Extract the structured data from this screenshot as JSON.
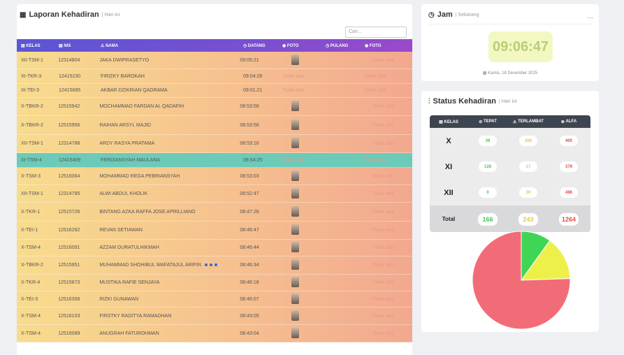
{
  "attendance": {
    "title": "Laporan Kehadiran",
    "subtitle": "| Hari ini",
    "search_placeholder": "Cari...",
    "columns": [
      "KELAS",
      "NIS",
      "NAMA",
      "DATANG",
      "FOTO",
      "PULANG",
      "FOTO"
    ],
    "rows": [
      {
        "kelas": "XII-TSM-1",
        "nis": "12314804",
        "nama": "JAKA DWIPRASETYO",
        "datang": "09:05:21",
        "foto_datang": "photo",
        "foto_pulang": "Tidak ada"
      },
      {
        "kelas": "XI-TKR-3",
        "nis": "12415230",
        "nama": "FIRIZKY BAROKAH",
        "datang": "09:04:28",
        "foto_datang": "Tidak ada",
        "foto_pulang": "Tidak ada"
      },
      {
        "kelas": "XI-TEI-3",
        "nis": "12415685",
        "nama": "AKBAR DZIKRIAN QADRAMA",
        "datang": "09:01:21",
        "foto_datang": "Tidak ada",
        "foto_pulang": "Tidak ada"
      },
      {
        "kelas": "X-TBKR-2",
        "nis": "12515942",
        "nama": "MOCHAMMAD FARDAN AL QADAFIH",
        "datang": "08:53:58",
        "foto_datang": "photo",
        "foto_pulang": "Tidak ada"
      },
      {
        "kelas": "X-TBKR-2",
        "nis": "12515956",
        "nama": "RAIHAN ARSYL MAJID",
        "datang": "08:53:56",
        "foto_datang": "photo",
        "foto_pulang": "Tidak ada"
      },
      {
        "kelas": "XII-TSM-1",
        "nis": "12314788",
        "nama": "ARDY RASYA PRATAMA",
        "datang": "08:53:16",
        "foto_datang": "photo",
        "foto_pulang": "Tidak ada"
      },
      {
        "kelas": "XI-TSM-4",
        "nis": "12415409",
        "nama": "FERDIANSYAH MAULANA",
        "datang": "08:54:25",
        "foto_datang": "Tidak ada",
        "foto_pulang": "Tidak ada",
        "highlight": true
      },
      {
        "kelas": "X-TSM-3",
        "nis": "12516064",
        "nama": "MOHAMMAD REGA PEBRIANSYAH",
        "datang": "08:53:03",
        "foto_datang": "photo",
        "foto_pulang": "Tidak ada"
      },
      {
        "kelas": "XII-TSM-1",
        "nis": "12314785",
        "nama": "ALWI ABDUL KHOLIK",
        "datang": "08:52:47",
        "foto_datang": "photo",
        "foto_pulang": "Tidak ada"
      },
      {
        "kelas": "X-TKR-1",
        "nis": "12515726",
        "nama": "BINTANG AZKA RAFFA JOSE APRILLIANO",
        "datang": "08:47:26",
        "foto_datang": "photo",
        "foto_pulang": "Tidak ada"
      },
      {
        "kelas": "X-TEI-1",
        "nis": "12516282",
        "nama": "REVAN SETIAWAN",
        "datang": "08:46:47",
        "foto_datang": "photo",
        "foto_pulang": "Tidak ada"
      },
      {
        "kelas": "X-TSM-4",
        "nis": "12516091",
        "nama": "AZZAM DURATULHIKMAH",
        "datang": "08:46:44",
        "foto_datang": "photo",
        "foto_pulang": "Tidak ada"
      },
      {
        "kelas": "X-TBKR-2",
        "nis": "12515951",
        "nama": "MUHAMMAD SHOHIBUL WAFATAJUL ARIFIN",
        "datang": "08:46:34",
        "foto_datang": "photo",
        "foto_pulang": "Tidak ada",
        "loading": true
      },
      {
        "kelas": "X-TKR-4",
        "nis": "12515873",
        "nama": "MUSTIKA RAFIE SENJAYA",
        "datang": "08:46:18",
        "foto_datang": "photo",
        "foto_pulang": "Tidak ada"
      },
      {
        "kelas": "X-TEI-3",
        "nis": "12516356",
        "nama": "RIZKI GUNAWAN",
        "datang": "08:46:07",
        "foto_datang": "photo",
        "foto_pulang": "Tidak ada"
      },
      {
        "kelas": "X-TSM-4",
        "nis": "12516103",
        "nama": "FIRSTKY RADITYA RAMADHAN",
        "datang": "08:43:05",
        "foto_datang": "photo",
        "foto_pulang": "Tidak ada"
      },
      {
        "kelas": "X-TSM-4",
        "nis": "12516089",
        "nama": "ANUGRAH FATUROHMAN",
        "datang": "08:43:04",
        "foto_datang": "photo",
        "foto_pulang": "Tidak ada"
      }
    ]
  },
  "jam": {
    "title": "Jam",
    "subtitle": "| Sekarang",
    "time": "09:06:47",
    "date": "Kamis, 18 Desember 2025"
  },
  "status": {
    "title": "Status Kehadiran",
    "subtitle": "| Hari ini",
    "columns": [
      "KELAS",
      "TEPAT",
      "TERLAMBAT",
      "ALFA"
    ],
    "rows": [
      {
        "kelas": "X",
        "tepat": "38",
        "terlambat": "206",
        "alfa": "400"
      },
      {
        "kelas": "XI",
        "tepat": "128",
        "terlambat": "17",
        "alfa": "378"
      },
      {
        "kelas": "XII",
        "tepat": "0",
        "terlambat": "20",
        "alfa": "486"
      }
    ],
    "total": {
      "label": "Total",
      "tepat": "166",
      "terlambat": "243",
      "alfa": "1264"
    }
  },
  "colors": {
    "tepat": "#3fd655",
    "terlambat": "#eef04a",
    "alfa": "#f26c78"
  },
  "chart_data": {
    "type": "pie",
    "categories": [
      "",
      "",
      ""
    ],
    "values": [
      166,
      243,
      1264
    ]
  }
}
